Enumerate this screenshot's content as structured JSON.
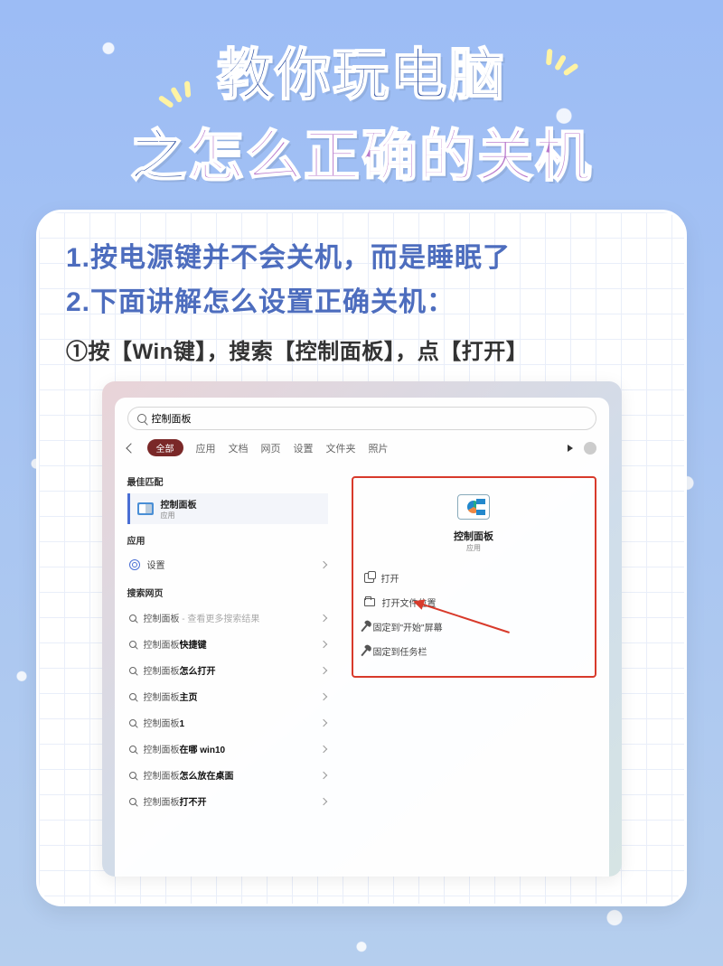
{
  "header": {
    "title_line1": "教你玩电脑",
    "title_line2_a": "之",
    "title_line2_b": "怎么正确的关机"
  },
  "card": {
    "point1": "1.按电源键并不会关机，而是睡眠了",
    "point2": "2.下面讲解怎么设置正确关机：",
    "step1": "①按【Win键】，搜索【控制面板】，点【打开】"
  },
  "search": {
    "value": "控制面板",
    "tabs": {
      "all": "全部",
      "apps": "应用",
      "docs": "文档",
      "web": "网页",
      "settings": "设置",
      "folders": "文件夹",
      "photos": "照片"
    },
    "sections": {
      "best_match": "最佳匹配",
      "apps": "应用",
      "web": "搜索网页"
    },
    "best_match": {
      "name": "控制面板",
      "type": "应用"
    },
    "app_item": "设置",
    "web_results": [
      {
        "prefix": "控制面板",
        "suffix": "",
        "gray": " - 查看更多搜索结果"
      },
      {
        "prefix": "控制面板",
        "suffix": "快捷键",
        "gray": ""
      },
      {
        "prefix": "控制面板",
        "suffix": "怎么打开",
        "gray": ""
      },
      {
        "prefix": "控制面板",
        "suffix": "主页",
        "gray": ""
      },
      {
        "prefix": "控制面板",
        "suffix": "1",
        "gray": ""
      },
      {
        "prefix": "控制面板",
        "suffix": "在哪 win10",
        "gray": ""
      },
      {
        "prefix": "控制面板",
        "suffix": "怎么放在桌面",
        "gray": ""
      },
      {
        "prefix": "控制面板",
        "suffix": "打不开",
        "gray": ""
      }
    ],
    "detail": {
      "name": "控制面板",
      "type": "应用",
      "actions": {
        "open": "打开",
        "open_location": "打开文件位置",
        "pin_start": "固定到\"开始\"屏幕",
        "pin_taskbar": "固定到任务栏"
      }
    }
  }
}
